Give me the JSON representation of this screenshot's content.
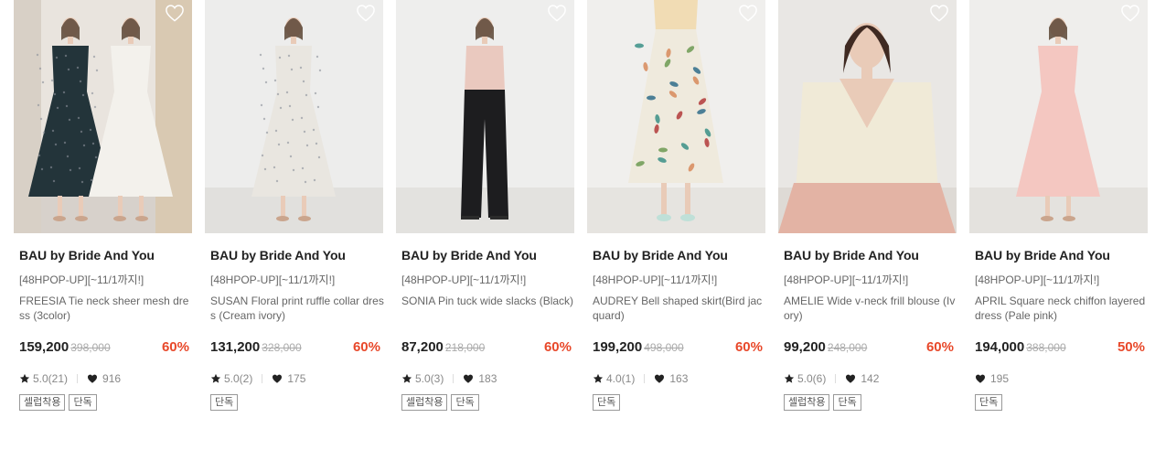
{
  "products": [
    {
      "brand": "BAU by Bride And You",
      "promo": "[48HPOP-UP][~11/1까지!]",
      "name": "FREESIA Tie neck sheer mesh dress (3color)",
      "price": "159,200",
      "original_price": "398,000",
      "discount": "60%",
      "rating": "5.0(21)",
      "likes": "916",
      "tags": [
        "셀럽착용",
        "단독"
      ],
      "photo": {
        "bg": "#e9e4de",
        "floor": "#d7d1cb",
        "subject": "two-models-dresses",
        "dress": "#23343a",
        "dress2": "#f3f1ec",
        "top": "#23343a"
      }
    },
    {
      "brand": "BAU by Bride And You",
      "promo": "[48HPOP-UP][~11/1까지!]",
      "name": "SUSAN Floral print ruffle collar dress (Cream ivory)",
      "price": "131,200",
      "original_price": "328,000",
      "discount": "60%",
      "rating": "5.0(2)",
      "likes": "175",
      "tags": [
        "단독"
      ],
      "photo": {
        "bg": "#ededec",
        "floor": "#e1e0dd",
        "subject": "model-dress",
        "dress": "#e9e6e0",
        "top": "#e9e6e0"
      }
    },
    {
      "brand": "BAU by Bride And You",
      "promo": "[48HPOP-UP][~11/1까지!]",
      "name": "SONIA Pin tuck wide slacks (Black)",
      "price": "87,200",
      "original_price": "218,000",
      "discount": "60%",
      "rating": "5.0(3)",
      "likes": "183",
      "tags": [
        "셀럽착용",
        "단독"
      ],
      "photo": {
        "bg": "#eeeeed",
        "floor": "#e3e2df",
        "subject": "model-slacks",
        "dress": "#1d1d1f",
        "top": "#eac9bf"
      }
    },
    {
      "brand": "BAU by Bride And You",
      "promo": "[48HPOP-UP][~11/1까지!]",
      "name": "AUDREY Bell shaped skirt(Bird jacquard)",
      "price": "199,200",
      "original_price": "498,000",
      "discount": "60%",
      "rating": "4.0(1)",
      "likes": "163",
      "tags": [
        "단독"
      ],
      "photo": {
        "bg": "#f0efed",
        "floor": "#e6e4e0",
        "subject": "model-skirt",
        "dress": "#efeadd",
        "top": "#f1dcb4"
      }
    },
    {
      "brand": "BAU by Bride And You",
      "promo": "[48HPOP-UP][~11/1까지!]",
      "name": "AMELIE Wide v-neck frill blouse (Ivory)",
      "price": "99,200",
      "original_price": "248,000",
      "discount": "60%",
      "rating": "5.0(6)",
      "likes": "142",
      "tags": [
        "셀럽착용",
        "단독"
      ],
      "photo": {
        "bg": "#e9e7e4",
        "floor": "#dedad5",
        "subject": "model-blouse",
        "dress": "#e3b3a4",
        "top": "#f0ead7"
      }
    },
    {
      "brand": "BAU by Bride And You",
      "promo": "[48HPOP-UP][~11/1까지!]",
      "name": "APRIL Square neck chiffon layered dress (Pale pink)",
      "price": "194,000",
      "original_price": "388,000",
      "discount": "50%",
      "rating": "",
      "likes": "195",
      "tags": [
        "단독"
      ],
      "photo": {
        "bg": "#efeeec",
        "floor": "#e4e2de",
        "subject": "model-pink-dress",
        "dress": "#f4c7c1",
        "top": "#f4c7c1"
      }
    }
  ],
  "colors": {
    "discount": "#e8482a",
    "star": "#222222",
    "heart": "#222222"
  },
  "icons": {
    "wishlist": "heart-outline-icon",
    "rating": "star-icon",
    "likes": "heart-filled-icon"
  }
}
